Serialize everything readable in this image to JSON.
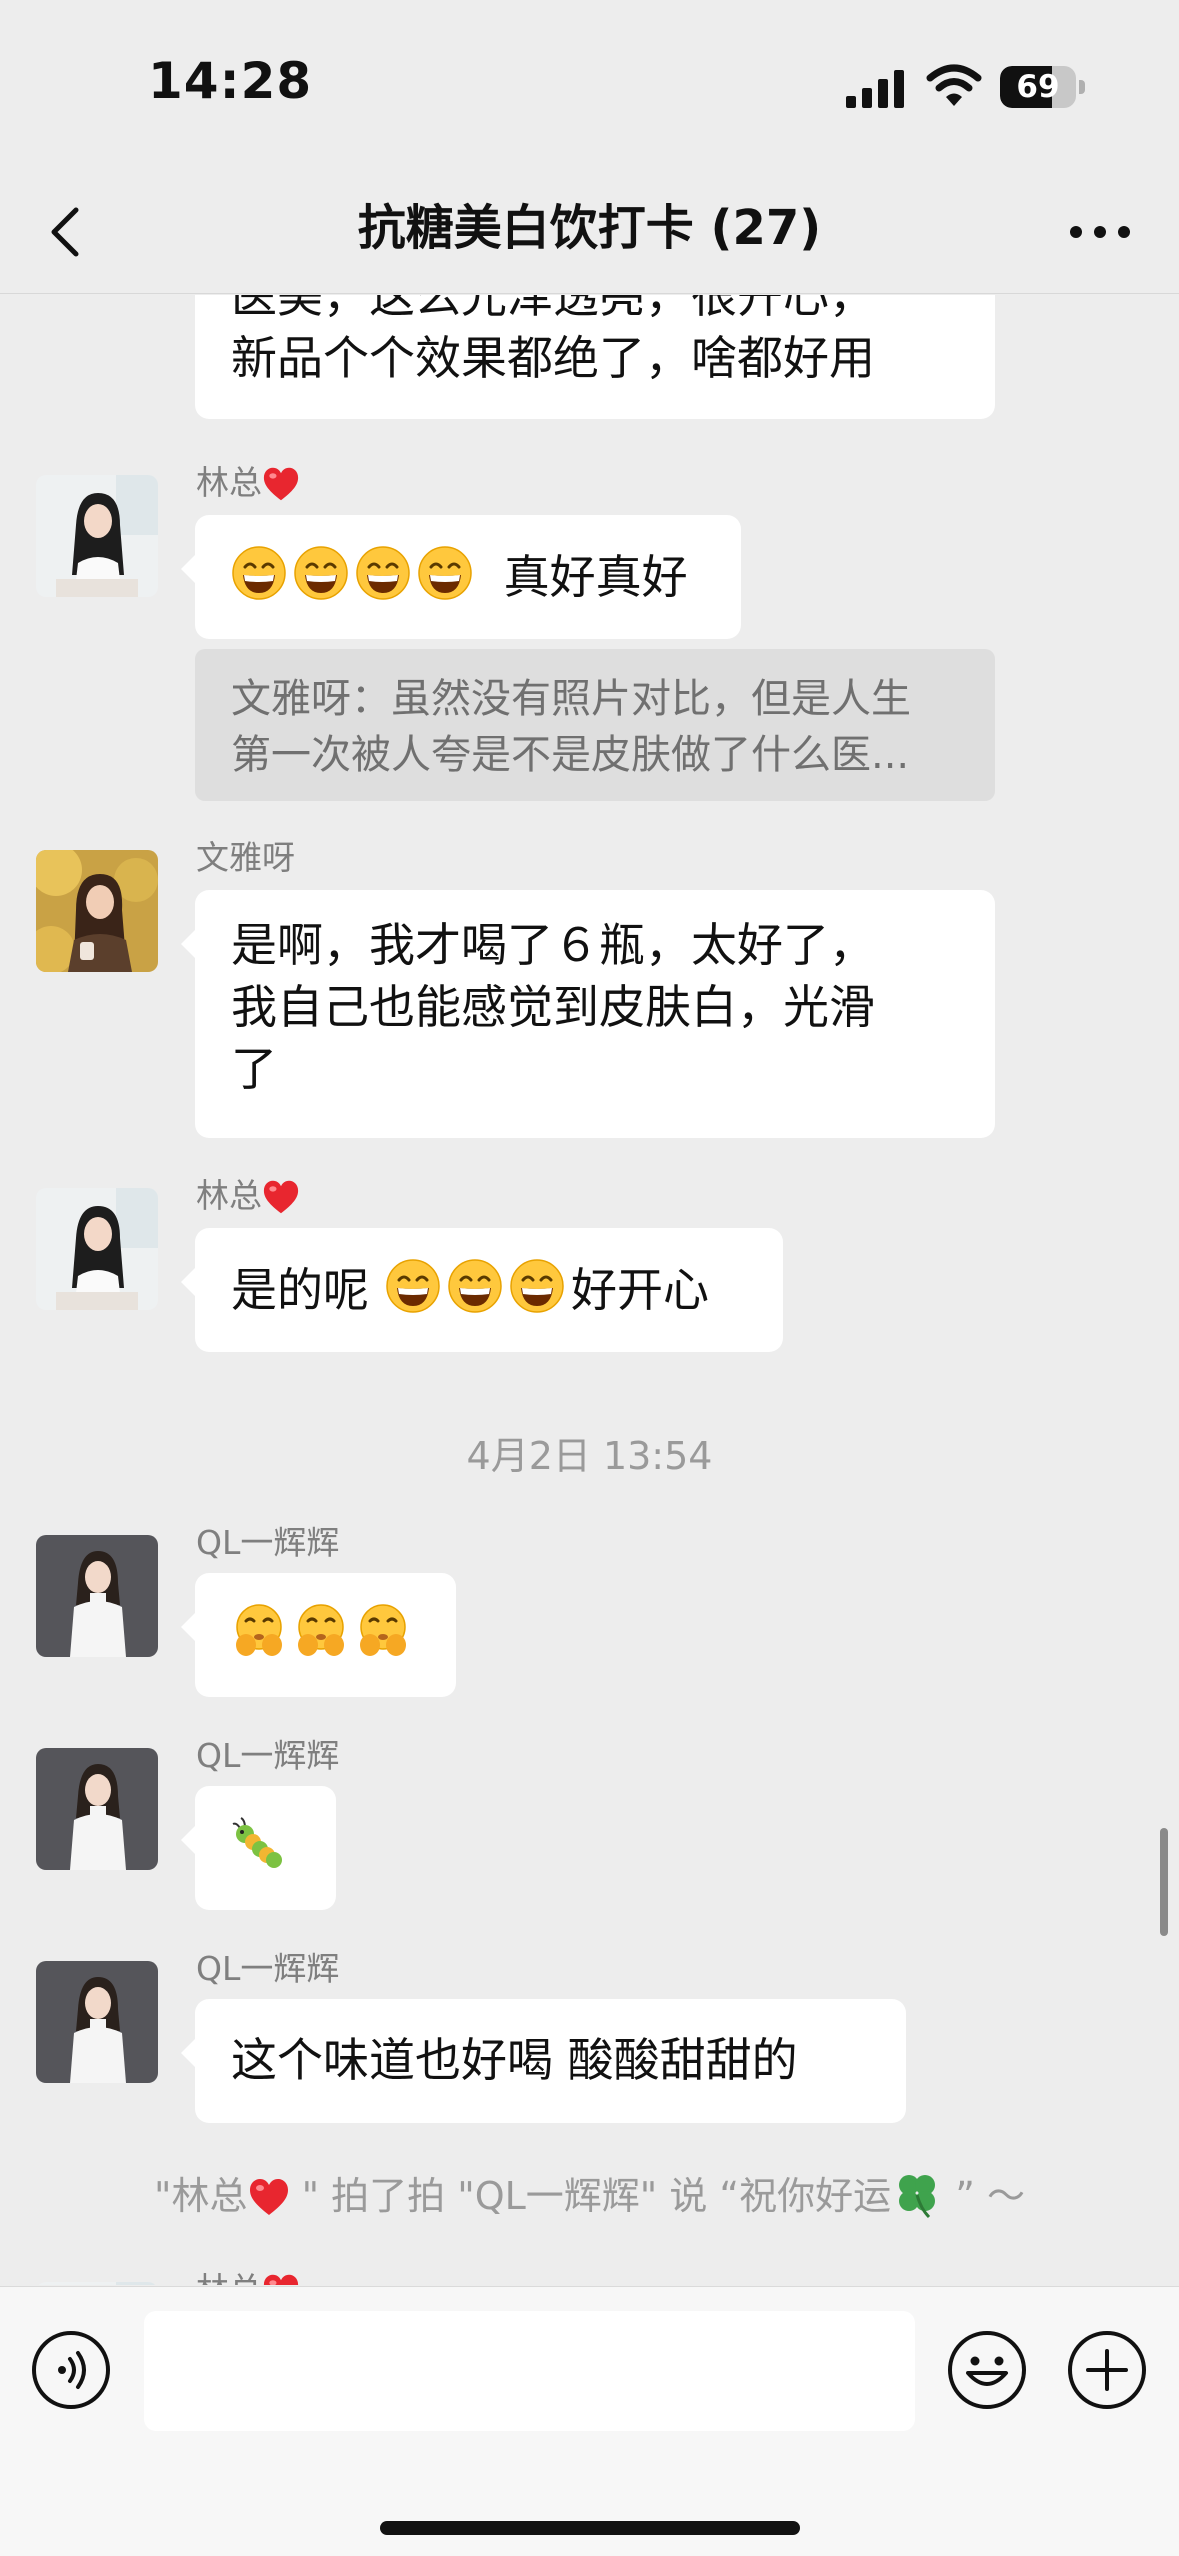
{
  "status_bar": {
    "time": "14:28",
    "battery": "69",
    "battery_level": 0.69
  },
  "nav": {
    "title": "抗糖美白饮打卡 (27)",
    "back_icon": "chevron-left-icon",
    "more_icon": "more-dots-icon"
  },
  "messages": {
    "m0": {
      "line1": "医美，这么光泽透亮，很开心，",
      "line2": "新品个个效果都绝了，啥都好用"
    },
    "m1": {
      "sender": "林总",
      "text": "真好真好",
      "emoji_count": 4
    },
    "m1_quote": {
      "line1": "文雅呀：虽然没有照片对比，但是人生",
      "line2": "第一次被人夸是不是皮肤做了什么医..."
    },
    "m2": {
      "sender": "文雅呀",
      "line1": "是啊，我才喝了６瓶，太好了，",
      "line2": "我自己也能感觉到皮肤白，光滑",
      "line3": "了"
    },
    "m3": {
      "sender": "林总",
      "text_before": "是的呢",
      "text_after": "好开心",
      "emoji_count": 3
    },
    "timestamp": "4月2日 13:54",
    "m4": {
      "sender": "QL一辉辉",
      "emoji": "shushing-face-emoji",
      "emoji_count": 3
    },
    "m5": {
      "sender": "QL一辉辉",
      "emoji": "caterpillar-emoji"
    },
    "m6": {
      "sender": "QL一辉辉",
      "text": "这个味道也好喝 酸酸甜甜的"
    },
    "system": {
      "part1": "\"林总",
      "part2": " \" 拍了拍 \"QL一辉辉\" 说 “祝你好运",
      "part3": " ” ～"
    },
    "m7": {
      "sender": "林总"
    }
  },
  "input_bar": {
    "placeholder": "",
    "voice_icon": "voice-icon",
    "emoji_icon": "emoji-face-icon",
    "plus_icon": "plus-circle-icon"
  },
  "colors": {
    "background": "#ededed",
    "bubble": "#ffffff",
    "quote_bg": "#dedede",
    "secondary_text": "#9a9a9a",
    "heart": "#e8262f"
  }
}
